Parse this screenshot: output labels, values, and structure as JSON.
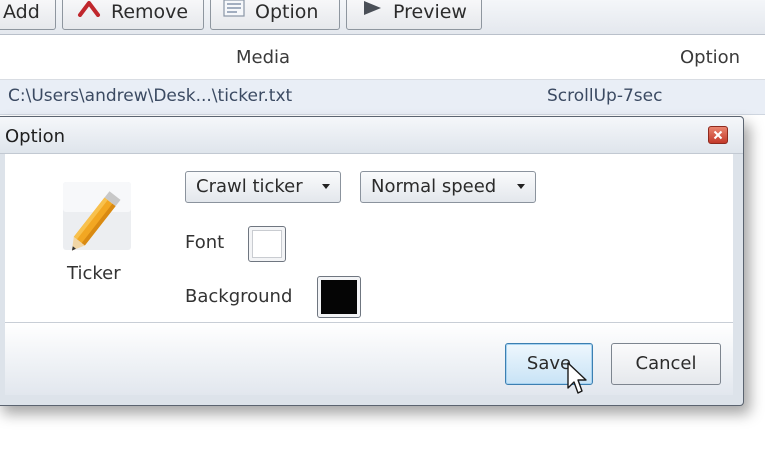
{
  "toolbar": {
    "add_label": "Add",
    "remove_label": "Remove",
    "option_label": "Option",
    "preview_label": "Preview",
    "remove_icon": "remove-chevron-icon",
    "option_icon": "list-icon",
    "preview_icon": "play-icon"
  },
  "grid": {
    "columns": [
      "Media",
      "Option"
    ],
    "rows": [
      {
        "media": "C:\\Users\\andrew\\Desk...\\ticker.txt",
        "option": "ScrollUp-7sec"
      }
    ]
  },
  "dialog": {
    "title": "Option",
    "close_icon": "close-icon",
    "ticker_icon": "pencil-icon",
    "ticker_label": "Ticker",
    "ticker_type": "Crawl ticker",
    "speed": "Normal speed",
    "font_label": "Font",
    "font_color": "#ffffff",
    "background_label": "Background",
    "background_color": "#000000",
    "save_label": "Save",
    "cancel_label": "Cancel"
  },
  "colors": {
    "accent_close": "#c3392a",
    "accent_remove": "#c0272d",
    "selected_row": "#e9eef6",
    "save_button": "#c8e3f6"
  }
}
